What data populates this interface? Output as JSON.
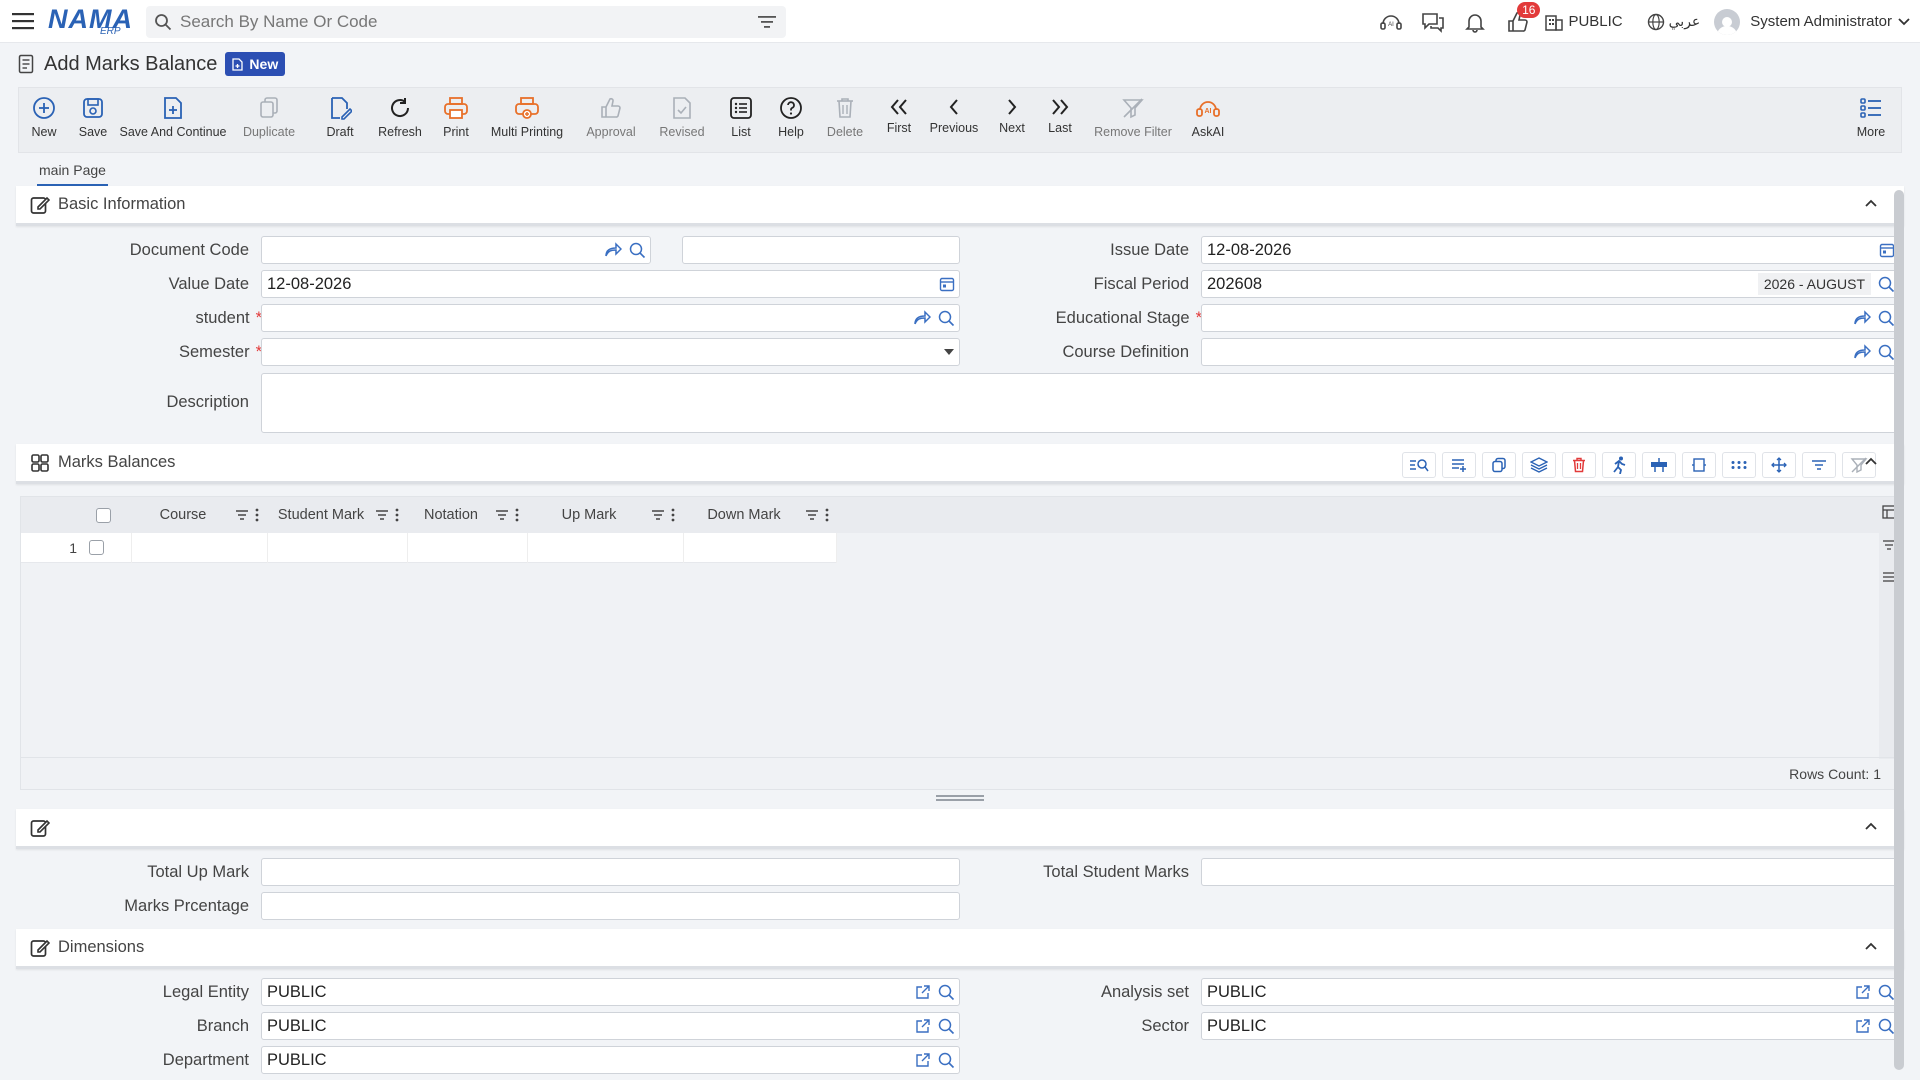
{
  "app": {
    "logo_main": "NAMA",
    "logo_sub": "ERP"
  },
  "search": {
    "placeholder": "Search By Name Or Code"
  },
  "topbar": {
    "notification_count": "16",
    "company": "PUBLIC",
    "language": "عربي",
    "user": "System Administrator"
  },
  "page": {
    "title": "Add Marks Balance",
    "status": "New"
  },
  "toolbar": {
    "new": "New",
    "save": "Save",
    "save_continue": "Save And Continue",
    "duplicate": "Duplicate",
    "draft": "Draft",
    "refresh": "Refresh",
    "print": "Print",
    "multi_printing": "Multi Printing",
    "approval": "Approval",
    "revised": "Revised",
    "list": "List",
    "help": "Help",
    "delete": "Delete",
    "first": "First",
    "previous": "Previous",
    "next": "Next",
    "last": "Last",
    "remove_filter": "Remove Filter",
    "askai": "AskAI",
    "more": "More"
  },
  "tabs": {
    "main": "main Page"
  },
  "basic": {
    "title": "Basic Information",
    "document_code_label": "Document Code",
    "document_code": "",
    "document_code_2": "",
    "issue_date_label": "Issue Date",
    "issue_date": "12-08-2026",
    "value_date_label": "Value Date",
    "value_date": "12-08-2026",
    "fiscal_period_label": "Fiscal Period",
    "fiscal_period": "202608",
    "fiscal_period_name": "2026 - AUGUST",
    "student_label": "student",
    "student": "",
    "educational_stage_label": "Educational Stage",
    "educational_stage": "",
    "semester_label": "Semester",
    "semester": "",
    "course_definition_label": "Course Definition",
    "course_definition": "",
    "description_label": "Description",
    "description": ""
  },
  "marks": {
    "title": "Marks Balances",
    "columns": [
      "Course",
      "Student Mark",
      "Notation",
      "Up Mark",
      "Down Mark"
    ],
    "rows": [
      {
        "num": "1"
      }
    ],
    "rows_count": "Rows Count: 1"
  },
  "totals": {
    "total_up_mark_label": "Total Up Mark",
    "total_up_mark": "",
    "total_student_marks_label": "Total Student Marks",
    "total_student_marks": "",
    "marks_percentage_label": "Marks Prcentage",
    "marks_percentage": ""
  },
  "dimensions": {
    "title": "Dimensions",
    "legal_entity_label": "Legal Entity",
    "legal_entity": "PUBLIC",
    "analysis_set_label": "Analysis set",
    "analysis_set": "PUBLIC",
    "branch_label": "Branch",
    "branch": "PUBLIC",
    "sector_label": "Sector",
    "sector": "PUBLIC",
    "department_label": "Department",
    "department": "PUBLIC"
  },
  "colors": {
    "brand": "#2a62b5",
    "badge": "#2c4fb3",
    "danger": "#e23a3a",
    "print": "#e8702a"
  }
}
